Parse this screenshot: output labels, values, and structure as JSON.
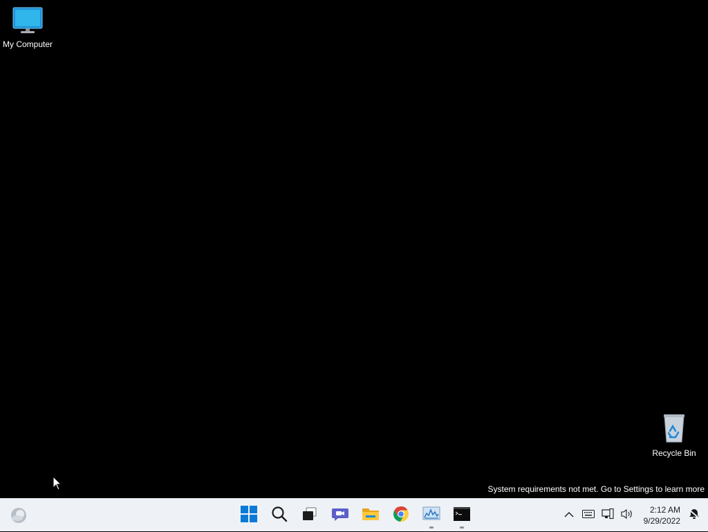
{
  "desktop": {
    "icons": [
      {
        "label": "My Computer",
        "icon": "monitor-icon"
      },
      {
        "label": "Recycle Bin",
        "icon": "recycle-bin-icon"
      }
    ],
    "watermark": "System requirements not met. Go to Settings to learn more"
  },
  "taskbar": {
    "widgets_icon": "widgets-icon",
    "pinned": [
      {
        "name": "Start",
        "icon": "windows-start-icon",
        "running": false
      },
      {
        "name": "Search",
        "icon": "search-icon",
        "running": false
      },
      {
        "name": "Task View",
        "icon": "task-view-icon",
        "running": false
      },
      {
        "name": "Chat",
        "icon": "chat-icon",
        "running": false
      },
      {
        "name": "File Explorer",
        "icon": "folder-icon",
        "running": false
      },
      {
        "name": "Google Chrome",
        "icon": "chrome-icon",
        "running": false
      },
      {
        "name": "Resource Monitor",
        "icon": "monitor-chart-icon",
        "running": true
      },
      {
        "name": "Command Prompt",
        "icon": "terminal-icon",
        "running": true
      }
    ],
    "tray": {
      "time": "2:12 AM",
      "date": "9/29/2022"
    }
  },
  "colors": {
    "desktop_bg": "#000000",
    "taskbar_bg": "#eef1f6",
    "start_blue": "#0078d4"
  }
}
